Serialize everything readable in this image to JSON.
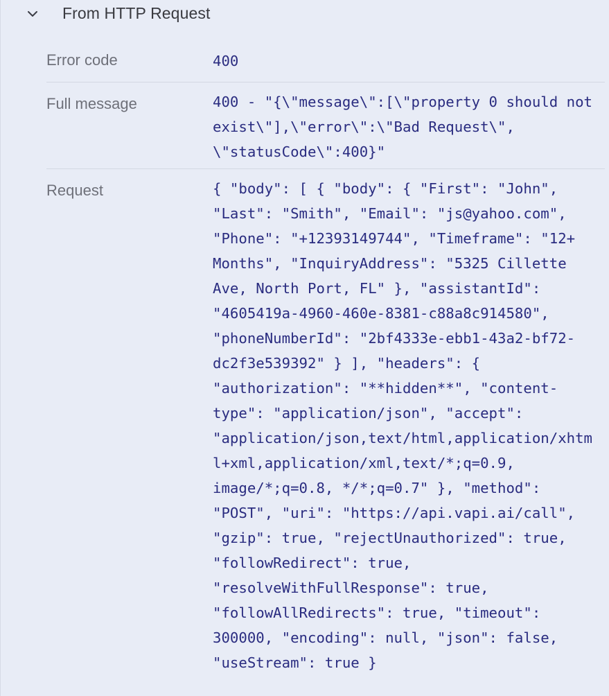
{
  "section": {
    "title": "From HTTP Request",
    "icon": "chevron-down-icon"
  },
  "rows": {
    "error_code": {
      "label": "Error code",
      "value": "400"
    },
    "full_message": {
      "label": "Full message",
      "value": "400 - \"{\\\"message\\\":[\\\"property 0 should not exist\\\"],\\\"error\\\":\\\"Bad Request\\\", \\\"statusCode\\\":400}\""
    },
    "request": {
      "label": "Request",
      "value": "{ \"body\": [ { \"body\": { \"First\": \"John\", \"Last\": \"Smith\", \"Email\": \"js@yahoo.com\", \"Phone\": \"+12393149744\", \"Timeframe\": \"12+ Months\", \"InquiryAddress\": \"5325 Cillette Ave, North Port, FL\" }, \"assistantId\": \"4605419a-4960-460e-8381-c88a8c914580\", \"phoneNumberId\": \"2bf4333e-ebb1-43a2-bf72-dc2f3e539392\" } ], \"headers\": { \"authorization\": \"**hidden**\", \"content-type\": \"application/json\", \"accept\": \"application/json,text/html,application/xhtml+xml,application/xml,text/*;q=0.9, image/*;q=0.8, */*;q=0.7\" }, \"method\": \"POST\", \"uri\": \"https://api.vapi.ai/call\", \"gzip\": true, \"rejectUnauthorized\": true, \"followRedirect\": true, \"resolveWithFullResponse\": true, \"followAllRedirects\": true, \"timeout\": 300000, \"encoding\": null, \"json\": false, \"useStream\": true }"
    }
  }
}
